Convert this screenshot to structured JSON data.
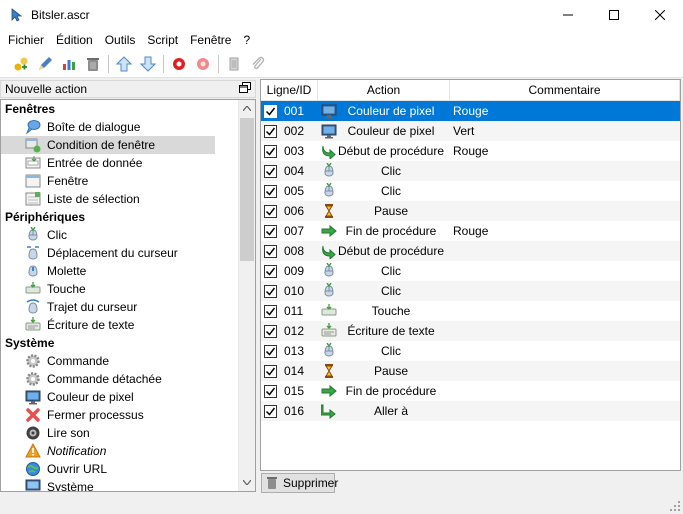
{
  "window": {
    "title": "Bitsler.ascr"
  },
  "menu": [
    "Fichier",
    "Édition",
    "Outils",
    "Script",
    "Fenêtre",
    "?"
  ],
  "toolbar": {
    "buttons": [
      "new-icon",
      "edit-icon",
      "chart-icon",
      "trash-icon",
      "arrow-up-icon",
      "arrow-down-icon",
      "record-icon",
      "record-stop-icon",
      "document-icon",
      "paperclip-icon"
    ]
  },
  "left_panel": {
    "title": "Nouvelle action",
    "groups": [
      {
        "label": "Fenêtres",
        "items": [
          {
            "label": "Boîte de dialogue",
            "icon": "dialog-icon"
          },
          {
            "label": "Condition de fenêtre",
            "icon": "window-condition-icon",
            "selected": true
          },
          {
            "label": "Entrée de donnée",
            "icon": "data-entry-icon"
          },
          {
            "label": "Fenêtre",
            "icon": "window-icon"
          },
          {
            "label": "Liste de sélection",
            "icon": "selection-list-icon"
          }
        ]
      },
      {
        "label": "Périphériques",
        "items": [
          {
            "label": "Clic",
            "icon": "mouse-click-icon"
          },
          {
            "label": "Déplacement du curseur",
            "icon": "cursor-move-icon"
          },
          {
            "label": "Molette",
            "icon": "mouse-wheel-icon"
          },
          {
            "label": "Touche",
            "icon": "key-icon"
          },
          {
            "label": "Trajet du curseur",
            "icon": "cursor-path-icon"
          },
          {
            "label": "Écriture de texte",
            "icon": "text-write-icon"
          }
        ]
      },
      {
        "label": "Système",
        "items": [
          {
            "label": "Commande",
            "icon": "gear-icon"
          },
          {
            "label": "Commande détachée",
            "icon": "gear-icon"
          },
          {
            "label": "Couleur de pixel",
            "icon": "monitor-icon"
          },
          {
            "label": "Fermer processus",
            "icon": "close-process-icon"
          },
          {
            "label": "Lire son",
            "icon": "speaker-icon"
          },
          {
            "label": "Notification",
            "icon": "warning-icon",
            "italic": true
          },
          {
            "label": "Ouvrir URL",
            "icon": "globe-icon"
          },
          {
            "label": "Système",
            "icon": "computer-icon"
          }
        ]
      }
    ]
  },
  "table": {
    "headers": [
      "Ligne/ID",
      "Action",
      "Commentaire"
    ],
    "rows": [
      {
        "id": "001",
        "action": "Couleur de pixel",
        "comment": "Rouge",
        "icon": "monitor-icon",
        "checked": true,
        "selected": true
      },
      {
        "id": "002",
        "action": "Couleur de pixel",
        "comment": "Vert",
        "icon": "monitor-icon",
        "checked": true
      },
      {
        "id": "003",
        "action": "Début de procédure",
        "comment": "Rouge",
        "icon": "procedure-start-icon",
        "checked": true
      },
      {
        "id": "004",
        "action": "Clic",
        "comment": "",
        "icon": "mouse-click-icon",
        "checked": true
      },
      {
        "id": "005",
        "action": "Clic",
        "comment": "",
        "icon": "mouse-click-icon",
        "checked": true
      },
      {
        "id": "006",
        "action": "Pause",
        "comment": "",
        "icon": "hourglass-icon",
        "checked": true
      },
      {
        "id": "007",
        "action": "Fin de procédure",
        "comment": "Rouge",
        "icon": "procedure-end-icon",
        "checked": true
      },
      {
        "id": "008",
        "action": "Début de procédure",
        "comment": "",
        "icon": "procedure-start-icon",
        "checked": true
      },
      {
        "id": "009",
        "action": "Clic",
        "comment": "",
        "icon": "mouse-click-icon",
        "checked": true
      },
      {
        "id": "010",
        "action": "Clic",
        "comment": "",
        "icon": "mouse-click-icon",
        "checked": true
      },
      {
        "id": "011",
        "action": "Touche",
        "comment": "",
        "icon": "key-icon",
        "checked": true
      },
      {
        "id": "012",
        "action": "Écriture de texte",
        "comment": "",
        "icon": "text-write-icon",
        "checked": true
      },
      {
        "id": "013",
        "action": "Clic",
        "comment": "",
        "icon": "mouse-click-icon",
        "checked": true
      },
      {
        "id": "014",
        "action": "Pause",
        "comment": "",
        "icon": "hourglass-icon",
        "checked": true
      },
      {
        "id": "015",
        "action": "Fin de procédure",
        "comment": "",
        "icon": "procedure-end-icon",
        "checked": true
      },
      {
        "id": "016",
        "action": "Aller à",
        "comment": "",
        "icon": "goto-icon",
        "checked": true
      }
    ]
  },
  "delete_button": {
    "label": "Supprimer"
  },
  "colors": {
    "selection": "#0078d7",
    "left_selection": "#d9d9d9"
  }
}
